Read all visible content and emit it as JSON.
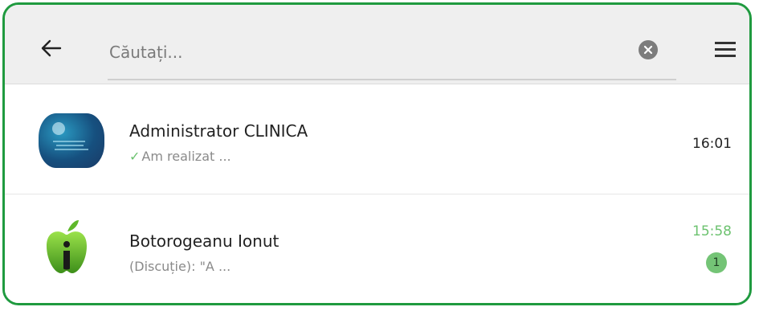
{
  "search": {
    "placeholder": "Căutați..."
  },
  "chats": [
    {
      "name": "Administrator CLINICA",
      "preview": "Am realizat ...",
      "time": "16:01",
      "read_status": "delivered"
    },
    {
      "name": "Botorogeanu Ionut",
      "preview": "(Discuție): \"A ...",
      "time": "15:58",
      "unread_count": "1"
    }
  ],
  "colors": {
    "frame": "#1f9a3f",
    "accent": "#6cc26f",
    "badge": "#74c476",
    "header_bg": "#efefef"
  },
  "icons": {
    "back": "arrow-left-icon",
    "clear": "clear-circle-icon",
    "menu": "hamburger-menu-icon",
    "check": "check-icon"
  }
}
